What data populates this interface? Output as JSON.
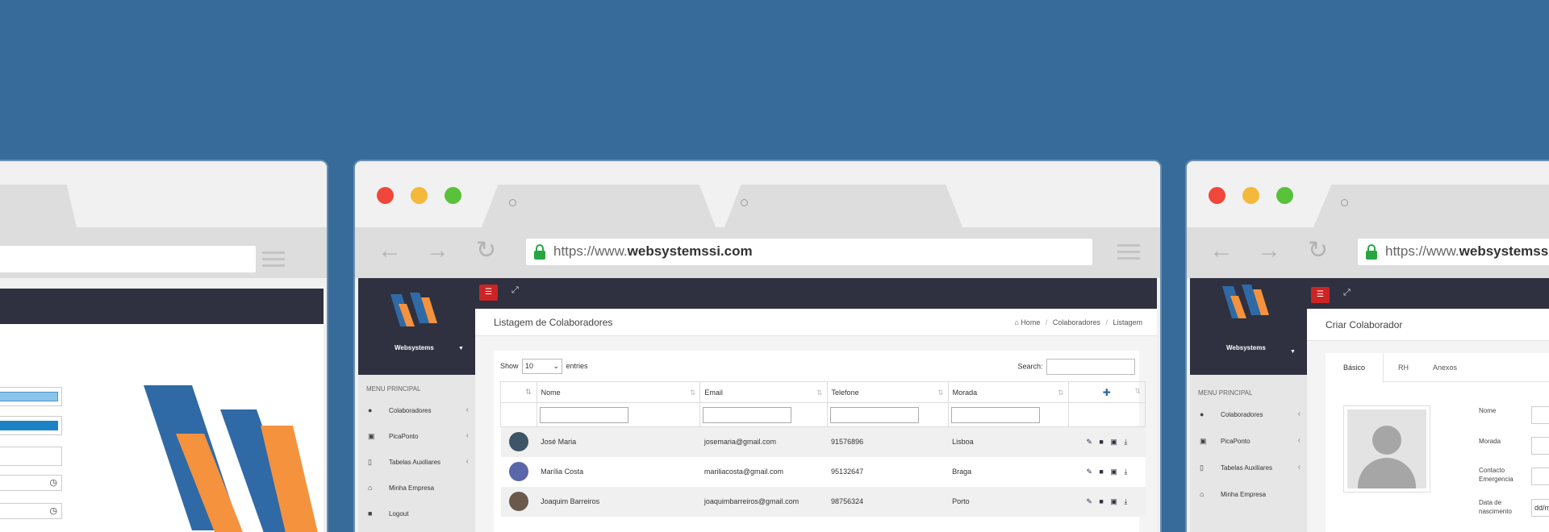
{
  "left_window": {
    "logo_label": "Websystems logo"
  },
  "center_window": {
    "url_prefix": "https://www.",
    "url_domain": "websystemssi.com",
    "brand": "Websystems",
    "menu_title": "MENU PRINCIPAL",
    "menu_items": [
      {
        "label": "Colaboradores",
        "icon": "users-icon"
      },
      {
        "label": "PicaPonto",
        "icon": "calendar-icon"
      },
      {
        "label": "Tabelas Auxiliares",
        "icon": "file-icon"
      },
      {
        "label": "Minha Empresa",
        "icon": "home-icon"
      },
      {
        "label": "Logout",
        "icon": "lock-icon"
      }
    ],
    "page_title": "Listagem de Colaboradores",
    "breadcrumb": {
      "home": "Home",
      "sep": "/",
      "section": "Colaboradores",
      "current": "Listagem"
    },
    "show_label": "Show",
    "show_value": "10",
    "entries_label": "entries",
    "search_label": "Search:",
    "columns": [
      "Nome",
      "Email",
      "Telefone",
      "Morada"
    ],
    "rows": [
      {
        "nome": "José Maria",
        "email": "josemaria@gmail.com",
        "telefone": "91576896",
        "morada": "Lisboa"
      },
      {
        "nome": "Marília Costa",
        "email": "mariliacosta@gmail.com",
        "telefone": "95132647",
        "morada": "Braga"
      },
      {
        "nome": "Joaquim Barreiros",
        "email": "joaquimbarreiros@gmail.com",
        "telefone": "98756324",
        "morada": "Porto"
      }
    ]
  },
  "right_window": {
    "url_prefix": "https://www.",
    "url_domain": "websystemssi.c",
    "brand": "Websystems",
    "menu_title": "MENU PRINCIPAL",
    "menu_items": [
      {
        "label": "Colaboradores",
        "icon": "users-icon"
      },
      {
        "label": "PicaPonto",
        "icon": "calendar-icon"
      },
      {
        "label": "Tabelas Auxiliares",
        "icon": "file-icon"
      },
      {
        "label": "Minha Empresa",
        "icon": "home-icon"
      }
    ],
    "page_title": "Criar Colaborador",
    "tabs": [
      "Básico",
      "RH",
      "Anexos"
    ],
    "fields": {
      "nome": "Nome",
      "morada": "Morada",
      "contacto_line1": "Contacto",
      "contacto_line2": "Emergencia",
      "data_line1": "Data de",
      "data_line2": "nascimento",
      "date_placeholder": "dd/mm"
    }
  },
  "colors": {
    "background": "#376b9a",
    "dark_bar": "#2f3140",
    "accent_red": "#cc2424",
    "logo_blue": "#2f6aa6",
    "logo_orange": "#f5923e"
  }
}
